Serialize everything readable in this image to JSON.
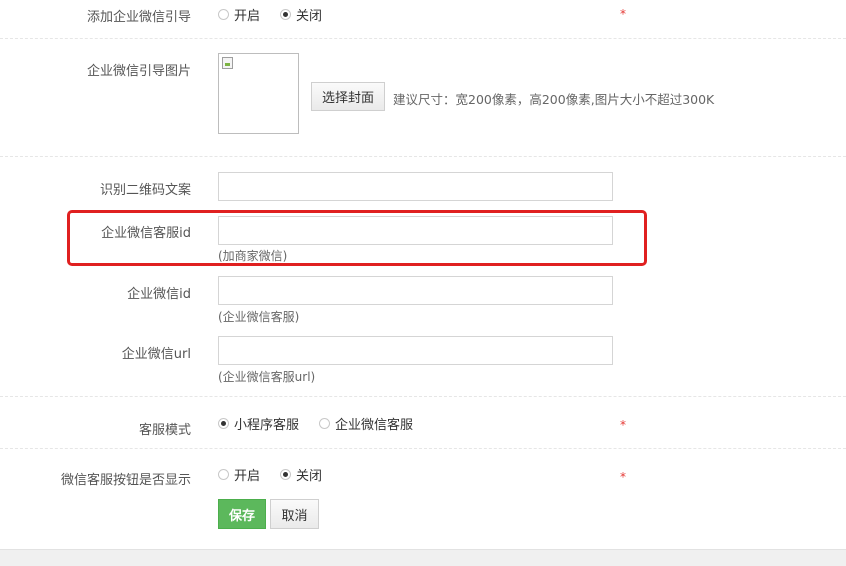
{
  "form": {
    "add_guide": {
      "label": "添加企业微信引导",
      "options": [
        {
          "label": "开启",
          "checked": false
        },
        {
          "label": "关闭",
          "checked": true
        }
      ],
      "required_mark": "*"
    },
    "guide_image": {
      "label": "企业微信引导图片",
      "choose_button": "选择封面",
      "size_hint": "建议尺寸：宽200像素，高200像素,图片大小不超过300K"
    },
    "qr_text": {
      "label": "识别二维码文案",
      "value": ""
    },
    "service_id": {
      "label": "企业微信客服id",
      "value": "",
      "hint": "(加商家微信)"
    },
    "wechat_id": {
      "label": "企业微信id",
      "value": "",
      "hint": "(企业微信客服)"
    },
    "wechat_url": {
      "label": "企业微信url",
      "value": "",
      "hint": "(企业微信客服url)"
    },
    "service_mode": {
      "label": "客服模式",
      "options": [
        {
          "label": "小程序客服",
          "checked": true
        },
        {
          "label": "企业微信客服",
          "checked": false
        }
      ],
      "required_mark": "*"
    },
    "show_button": {
      "label": "微信客服按钮是否显示",
      "options": [
        {
          "label": "开启",
          "checked": false
        },
        {
          "label": "关闭",
          "checked": true
        }
      ],
      "required_mark": "*"
    },
    "actions": {
      "save": "保存",
      "cancel": "取消"
    }
  },
  "colors": {
    "primary": "#5cb85c",
    "required": "#e53935",
    "highlight": "#e02020"
  },
  "icons": {
    "broken_image": "broken-image-icon"
  }
}
